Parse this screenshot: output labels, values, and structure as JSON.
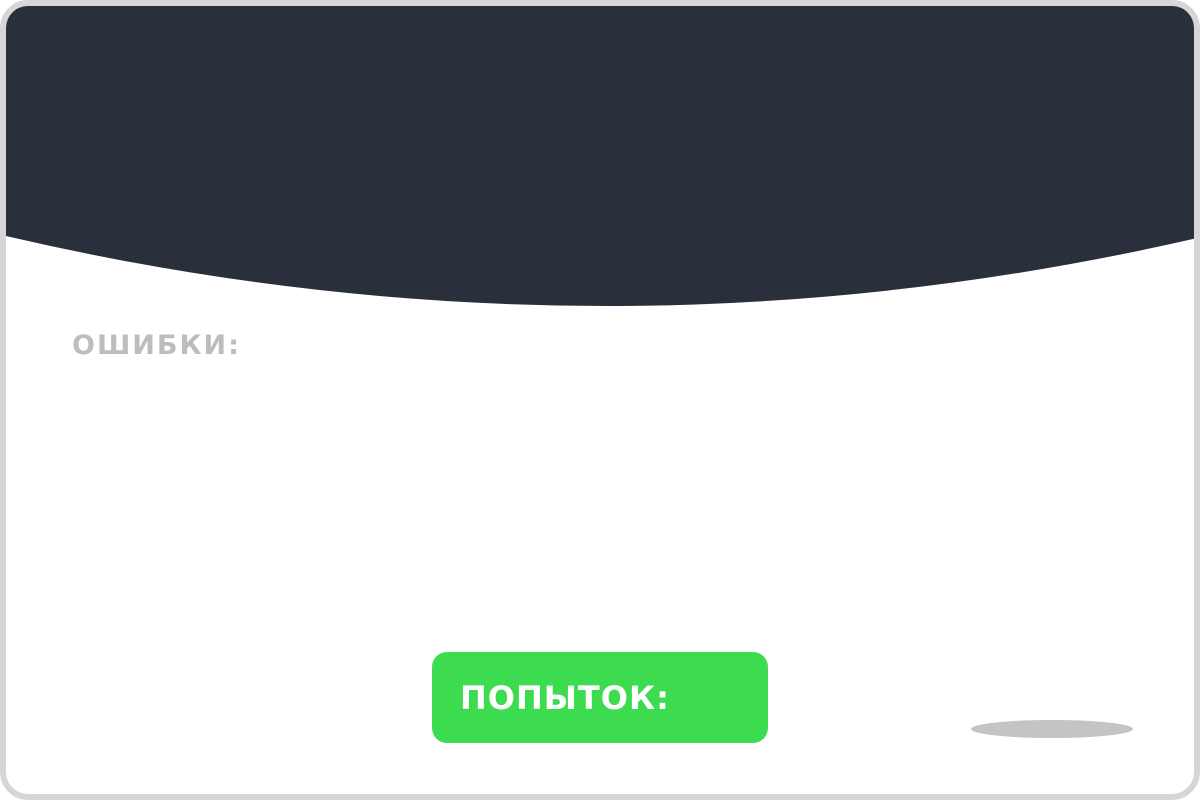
{
  "colors": {
    "header_background": "#2a303b",
    "frame_border": "#d6d6d6",
    "page_background": "#ffffff",
    "errors_label_color": "#bdbdbd",
    "attempts_box_color": "#3ddc50",
    "attempts_text_color": "#ffffff",
    "shadow_color": "#c4c4c4"
  },
  "errors": {
    "label": "ОШИБКИ:",
    "value": ""
  },
  "attempts": {
    "label": "ПОПЫТОК:",
    "value": ""
  }
}
